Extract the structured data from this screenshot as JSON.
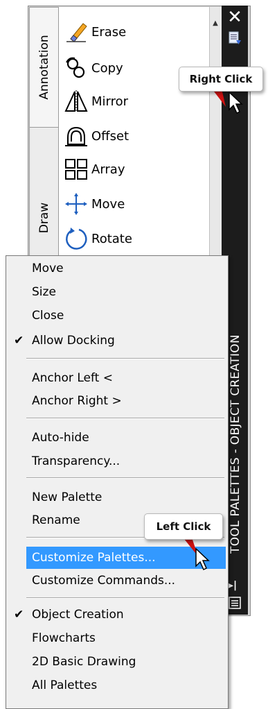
{
  "palette": {
    "title": "TOOL PALETTES - OBJECT CREATION",
    "tabs": [
      {
        "label": "Annotation"
      },
      {
        "label": "Draw"
      }
    ],
    "tools": [
      {
        "label": "Erase",
        "icon": "eraser-icon"
      },
      {
        "label": "Copy",
        "icon": "copy-icon"
      },
      {
        "label": "Mirror",
        "icon": "mirror-icon"
      },
      {
        "label": "Offset",
        "icon": "offset-icon"
      },
      {
        "label": "Array",
        "icon": "array-icon"
      },
      {
        "label": "Move",
        "icon": "move-icon"
      },
      {
        "label": "Rotate",
        "icon": "rotate-icon"
      }
    ]
  },
  "callouts": {
    "right_click": "Right Click",
    "left_click": "Left Click"
  },
  "context_menu": {
    "groups": [
      [
        {
          "label": "Move",
          "checked": false
        },
        {
          "label": "Size",
          "checked": false
        },
        {
          "label": "Close",
          "checked": false
        },
        {
          "label": "Allow Docking",
          "checked": true
        }
      ],
      [
        {
          "label": "Anchor Left   <",
          "checked": false
        },
        {
          "label": "Anchor Right  >",
          "checked": false
        }
      ],
      [
        {
          "label": "Auto-hide",
          "checked": false
        },
        {
          "label": "Transparency...",
          "checked": false
        }
      ],
      [
        {
          "label": "New Palette",
          "checked": false
        },
        {
          "label": "Rename",
          "checked": false
        }
      ],
      [
        {
          "label": "Customize Palettes...",
          "checked": false,
          "highlighted": true
        },
        {
          "label": "Customize Commands...",
          "checked": false
        }
      ],
      [
        {
          "label": "Object Creation",
          "checked": true
        },
        {
          "label": "Flowcharts",
          "checked": false
        },
        {
          "label": "2D Basic Drawing",
          "checked": false
        },
        {
          "label": "All Palettes",
          "checked": false
        }
      ]
    ]
  },
  "colors": {
    "highlight": "#3399ff",
    "titlebar": "#1c1c1c",
    "callout_pointer": "#cc1111"
  }
}
